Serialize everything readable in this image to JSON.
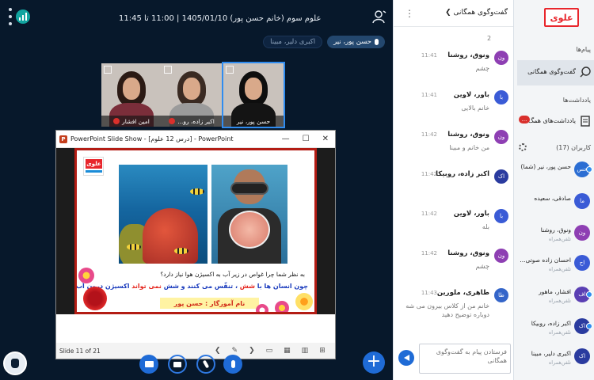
{
  "meeting": {
    "title": "علوم سوم (خانم حسن پور) 1405/01/10 | 11:00 تا 11:45",
    "talking": [
      {
        "name": "حسن پور، نیر",
        "active": true
      },
      {
        "name": "اکبری دلیر، مبینا",
        "active": false
      }
    ],
    "webcams": [
      {
        "label": "امین افشار",
        "hair": "#2b1a14",
        "shirt": "#7b2e3a",
        "speaking": false,
        "muted": true
      },
      {
        "label": "اکبر زاده، رو...",
        "hair": "#3a2a22",
        "shirt": "#9b9b9b",
        "speaking": false,
        "muted": true
      },
      {
        "label": "حسن پور، نیر",
        "hair": "#0e0e0e",
        "shirt": "#141414",
        "speaking": true,
        "muted": false
      }
    ]
  },
  "ppt": {
    "window_title": "PowerPoint Slide Show - [درس 12 علوم] - PowerPoint",
    "logo": "P",
    "slide_status": "Slide 11 of 21",
    "slide": {
      "brand": "علوی",
      "question": "به نظر شما چرا غواص در زیر آب به اکسیژن هوا نیاز دارد؟",
      "answer_part1": "چون انسان ها با ",
      "answer_hl1": "شش",
      "answer_part2": " ، تنفّس می کنند و شش ",
      "answer_hl2": "نمی تواند",
      "answer_part3": " اکسیژن درون آب دریافت کند .",
      "teacher": "نام آموزگار : حسن پور"
    }
  },
  "chat": {
    "title": "گفت‌وگوی همگانی",
    "first_line": "2",
    "messages": [
      {
        "initials": "ون",
        "name": "ونوق، روشنا",
        "time": "11:41",
        "text": "چشم",
        "color": "#8e3fb3"
      },
      {
        "initials": "با",
        "name": "باور، لاوین",
        "time": "11:41",
        "text": "خانم بالایی",
        "color": "#3a5bd6"
      },
      {
        "initials": "ون",
        "name": "ونوق، روشنا",
        "time": "11:42",
        "text": "من خانم و مبینا",
        "color": "#8e3fb3"
      },
      {
        "initials": "اک",
        "name": "اکبر زاده، روبیکا",
        "time": "11:42",
        "text": "",
        "color": "#2a3b9f"
      },
      {
        "initials": "با",
        "name": "باور، لاوین",
        "time": "11:42",
        "text": "بله",
        "color": "#3a5bd6"
      },
      {
        "initials": "ون",
        "name": "ونوق، روشنا",
        "time": "11:42",
        "text": "چشم",
        "color": "#8e3fb3"
      },
      {
        "initials": "طا",
        "name": "طاهری، ملورین",
        "time": "11:43",
        "text": "خانم من از کلاس بیرون می شه دوباره توضیح دهید",
        "color": "#3465c9"
      }
    ],
    "input_placeholder": "فرستادن پیام به گفت‌وگوی همگانی"
  },
  "sidebar": {
    "logo": "علوی",
    "messages_heading": "پیام‌ها",
    "public_chat_label": "گفت‌وگوی همگانی",
    "notes_heading": "یادداشت‌ها",
    "shared_notes_label": "یادداشت‌های همگ...",
    "notes_badge": "...",
    "users_heading": "کاربران (17)",
    "users": [
      {
        "initials": "حس",
        "name": "حسن پور، نیر (شما)",
        "role": "",
        "color": "#2b6ed3",
        "cam": true
      },
      {
        "initials": "ما",
        "name": "صادقی، سعیده",
        "role": "",
        "color": "#3a5bd6",
        "cam": false
      },
      {
        "initials": "ون",
        "name": "ونوق، روشنا",
        "role": "تلفن‌همراه",
        "color": "#8e3fb3",
        "cam": false
      },
      {
        "initials": "اح",
        "name": "احسان زاده صوتی...",
        "role": "تلفن‌همراه",
        "color": "#3a5bd6",
        "cam": false
      },
      {
        "initials": "اف",
        "name": "افشار، ماهور",
        "role": "تلفن‌همراه",
        "color": "#5a3fb3",
        "cam": true
      },
      {
        "initials": "اک",
        "name": "اکبر زاده، روبیکا",
        "role": "تلفن‌همراه",
        "color": "#2a3b9f",
        "cam": true
      },
      {
        "initials": "اک",
        "name": "اکبری دلیر، مبینا",
        "role": "تلفن‌همراه",
        "color": "#2a3b9f",
        "cam": false
      }
    ]
  }
}
